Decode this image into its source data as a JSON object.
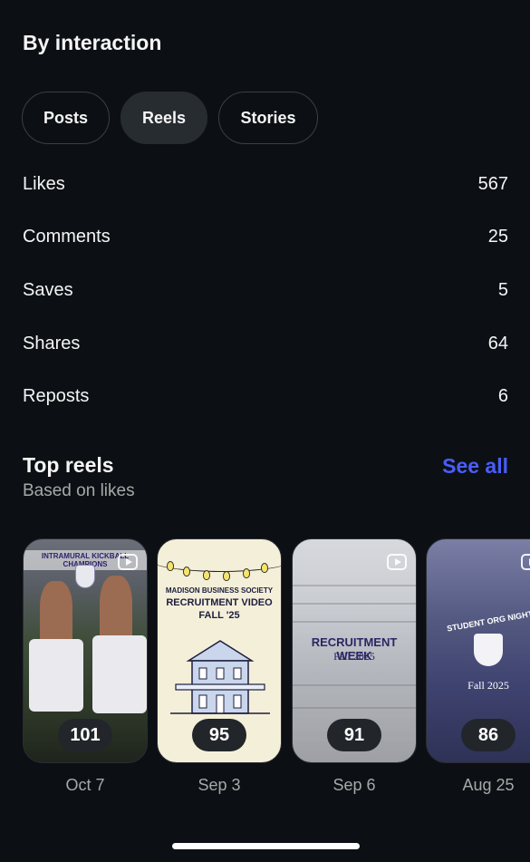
{
  "section": {
    "title": "By interaction"
  },
  "filters": [
    {
      "label": "Posts",
      "selected": false
    },
    {
      "label": "Reels",
      "selected": true
    },
    {
      "label": "Stories",
      "selected": false
    }
  ],
  "metrics": [
    {
      "label": "Likes",
      "value": "567"
    },
    {
      "label": "Comments",
      "value": "25"
    },
    {
      "label": "Saves",
      "value": "5"
    },
    {
      "label": "Shares",
      "value": "64"
    },
    {
      "label": "Reposts",
      "value": "6"
    }
  ],
  "top_reels": {
    "title": "Top reels",
    "subtitle": "Based on likes",
    "see_all": "See all",
    "items": [
      {
        "count": "101",
        "date": "Oct 7",
        "thumb_text": "INTRAMURAL KICKBALL CHAMPIONS"
      },
      {
        "count": "95",
        "date": "Sep 3",
        "thumb_text_1": "MADISON BUSINESS SOCIETY",
        "thumb_text_2": "RECRUITMENT VIDEO",
        "thumb_text_3": "FALL '25"
      },
      {
        "count": "91",
        "date": "Sep 6",
        "thumb_text_1": "RECRUITMENT WEEK",
        "thumb_text_2": "Fall 2025"
      },
      {
        "count": "86",
        "date": "Aug 25",
        "thumb_text_1": "STUDENT ORG NIGHT RE",
        "thumb_text_2": "Fall 2025"
      }
    ]
  },
  "colors": {
    "background": "#0c1014",
    "accent_link": "#4a5df9",
    "chip_selected": "#272c31",
    "secondary_text": "#a8a8a8"
  }
}
